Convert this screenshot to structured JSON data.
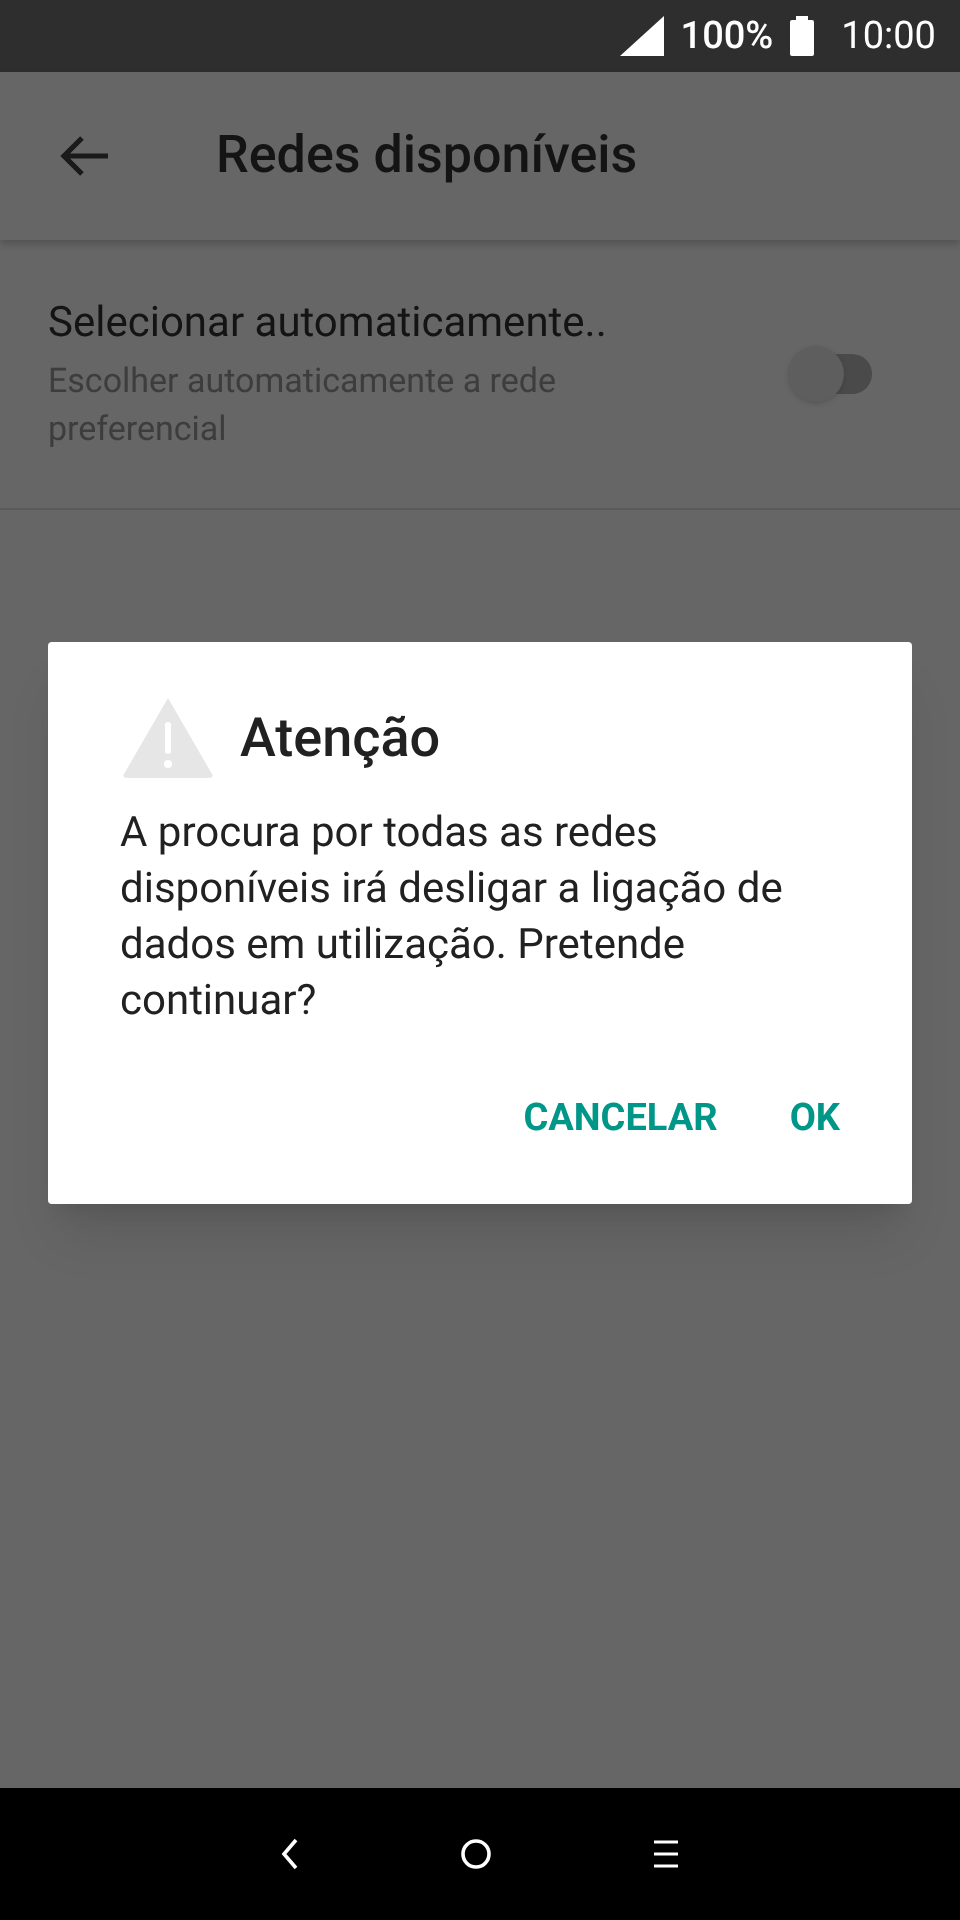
{
  "status_bar": {
    "battery": "100%",
    "time": "10:00"
  },
  "app_bar": {
    "title": "Redes disponíveis"
  },
  "settings": [
    {
      "title": "Selecionar automaticamente..",
      "subtitle": "Escolher automaticamente a rede preferencial",
      "on": false
    }
  ],
  "dialog": {
    "title": "Atenção",
    "message": "A procura por todas as redes disponíveis irá desligar a ligação de dados em utilização. Pretende continuar?",
    "buttons": [
      "CANCELAR",
      "OK"
    ]
  }
}
